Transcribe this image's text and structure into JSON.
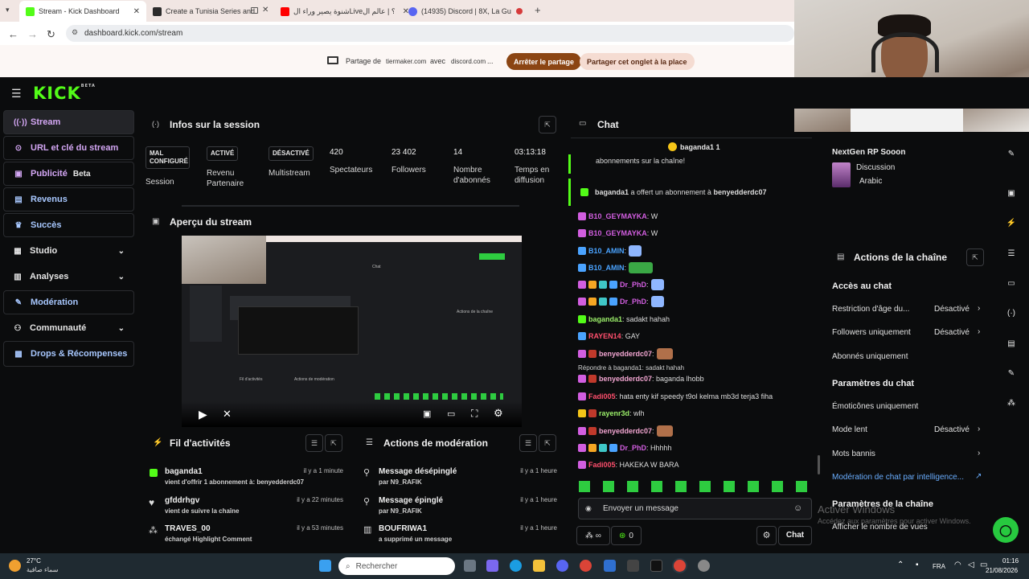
{
  "browser": {
    "tabs": [
      {
        "title": "Stream - Kick Dashboard",
        "color": "#53fc18"
      },
      {
        "title": "Create a Tunisia Series and",
        "color": "#2b2b2b"
      },
      {
        "title": "شنوة يصير وراء الLive؟ | عالم ال",
        "color": "#ff0000"
      },
      {
        "title": "(14935) Discord | 8X, La Gu",
        "color": "#5865f2"
      }
    ],
    "url": "dashboard.kick.com/stream",
    "share": {
      "prefix": "Partage de",
      "site1": "tiermaker.com",
      "mid": "avec",
      "site2": "discord.com",
      "ellipsis": "...",
      "stop_label": "Arrêter le partage",
      "share_here_label": "Partager cet onglet à la place"
    }
  },
  "header": {
    "logo": "KICK",
    "logo_sup": "BETA"
  },
  "sidebar": {
    "items": [
      {
        "label": "Stream"
      },
      {
        "label": "URL et clé du stream"
      },
      {
        "label": "Publicité",
        "badge": "Beta"
      },
      {
        "label": "Revenus"
      },
      {
        "label": "Succès"
      },
      {
        "label": "Studio"
      },
      {
        "label": "Analyses"
      },
      {
        "label": "Modération"
      },
      {
        "label": "Communauté"
      },
      {
        "label": "Drops & Récompenses"
      }
    ]
  },
  "session": {
    "title": "Infos sur la session",
    "badges": [
      {
        "state": "MAL CONFIGURÉ",
        "label": "Session"
      },
      {
        "state": "ACTIVÉ",
        "label": "Revenu Partenaire"
      },
      {
        "state": "DÉSACTIVÉ",
        "label": "Multistream"
      }
    ],
    "stats": [
      {
        "value": "420",
        "label": "Spectateurs"
      },
      {
        "value": "23 402",
        "label": "Followers"
      },
      {
        "value": "14",
        "label": "Nombre d'abonnés"
      },
      {
        "value": "03:13:18",
        "label": "Temps en diffusion"
      }
    ]
  },
  "preview": {
    "title": "Aperçu du stream",
    "mini_chat": "Chat",
    "mini_actions": "Actions de la chaîne",
    "mini_feed": "Fil d'activités",
    "mini_mod": "Actions de modération"
  },
  "activity": {
    "title": "Fil d'activités",
    "items": [
      {
        "name": "baganda1",
        "text": "vient d'offrir 1 abonnement à: benyedderdc07",
        "time": "il y a 1 minute"
      },
      {
        "name": "gfddrhgv",
        "text": "vient de suivre la chaîne",
        "time": "il y a 22 minutes"
      },
      {
        "name": "TRAVES_00",
        "text": "échangé Highlight Comment",
        "time": "il y a 53 minutes"
      }
    ]
  },
  "moderation": {
    "title": "Actions de modération",
    "items": [
      {
        "name": "Message désépinglé",
        "text": "par N9_RAFIK",
        "time": "il y a 1 heure"
      },
      {
        "name": "Message épinglé",
        "text": "par N9_RAFIK",
        "time": "il y a 1 heure"
      },
      {
        "name": "BOUFRIWA1",
        "text": "a supprimé un message",
        "time": "il y a 1 heure"
      }
    ]
  },
  "chat": {
    "title": "Chat",
    "pinned_user": "baganda1 1",
    "sub_tail": "abonnements sur la chaîne!",
    "gift": {
      "user": "baganda1",
      "text": "a offert un abonnement à",
      "target": "benyedderdc07"
    },
    "messages": [
      {
        "user": "B10_GEYMAYKA",
        "text": ": W",
        "color": "#d25ee0"
      },
      {
        "user": "B10_GEYMAYKA",
        "text": ": W",
        "color": "#d25ee0"
      },
      {
        "user": "B10_AMIN",
        "text": ":",
        "color": "#4aa3ff"
      },
      {
        "user": "B10_AMIN",
        "text": ":",
        "color": "#4aa3ff"
      },
      {
        "user": "Dr_PhD",
        "text": ":",
        "color": "#d25ee0"
      },
      {
        "user": "Dr_PhD",
        "text": ":",
        "color": "#d25ee0"
      },
      {
        "user": "baganda1",
        "text": ": sadakt hahah",
        "color": "#9cf06a"
      },
      {
        "user": "RAYEN14",
        "text": ": GAY",
        "color": "#ff4f6d"
      },
      {
        "user": "benyedderdc07",
        "text": ":",
        "color": "#f3a6d2"
      },
      {
        "user": "benyedderdc07",
        "text": ": baganda lhobb",
        "color": "#f3a6d2"
      },
      {
        "user": "Fadi005",
        "text": ": hata enty kif speedy t9ol kelma mb3d terja3 fiha",
        "color": "#ff4f6d"
      },
      {
        "user": "rayenr3d",
        "text": ": wlh",
        "color": "#9cf06a"
      },
      {
        "user": "benyedderdc07",
        "text": ":",
        "color": "#f3a6d2"
      },
      {
        "user": "Dr_PhD",
        "text": ": Hhhhh",
        "color": "#d25ee0"
      },
      {
        "user": "Fadi005",
        "text": ": HAKEKA W BARA",
        "color": "#ff4f6d"
      }
    ],
    "reply": "Répondre à baganda1: sadakt hahah",
    "input_placeholder": "Envoyer un message",
    "points": "0",
    "send_label": "Chat"
  },
  "stream_info": {
    "title": "NextGen RP Sooon",
    "category": "Discussion",
    "language": "Arabic"
  },
  "channel_actions": {
    "title": "Actions de la chaîne",
    "section1": "Accès au chat",
    "rows1": [
      {
        "label": "Restriction d'âge du...",
        "value": "Désactivé"
      },
      {
        "label": "Followers uniquement",
        "value": "Désactivé"
      },
      {
        "label": "Abonnés uniquement",
        "value": ""
      }
    ],
    "section2": "Paramètres du chat",
    "rows2": [
      {
        "label": "Émoticônes uniquement",
        "value": ""
      },
      {
        "label": "Mode lent",
        "value": "Désactivé"
      },
      {
        "label": "Mots bannis",
        "value": ""
      },
      {
        "label": "Modération de chat par intelligence...",
        "value": ""
      }
    ],
    "section3": "Paramètres de la chaîne",
    "row3": "Afficher le nombre de vues"
  },
  "watermark": {
    "line1": "Activer Windows",
    "line2": "Accédez aux paramètres pour activer Windows."
  },
  "taskbar": {
    "weather_temp": "27°C",
    "weather_desc": "سماء صافية",
    "search_placeholder": "Rechercher",
    "lang": "FRA",
    "time": "01:16",
    "date": "21/08/2026"
  }
}
